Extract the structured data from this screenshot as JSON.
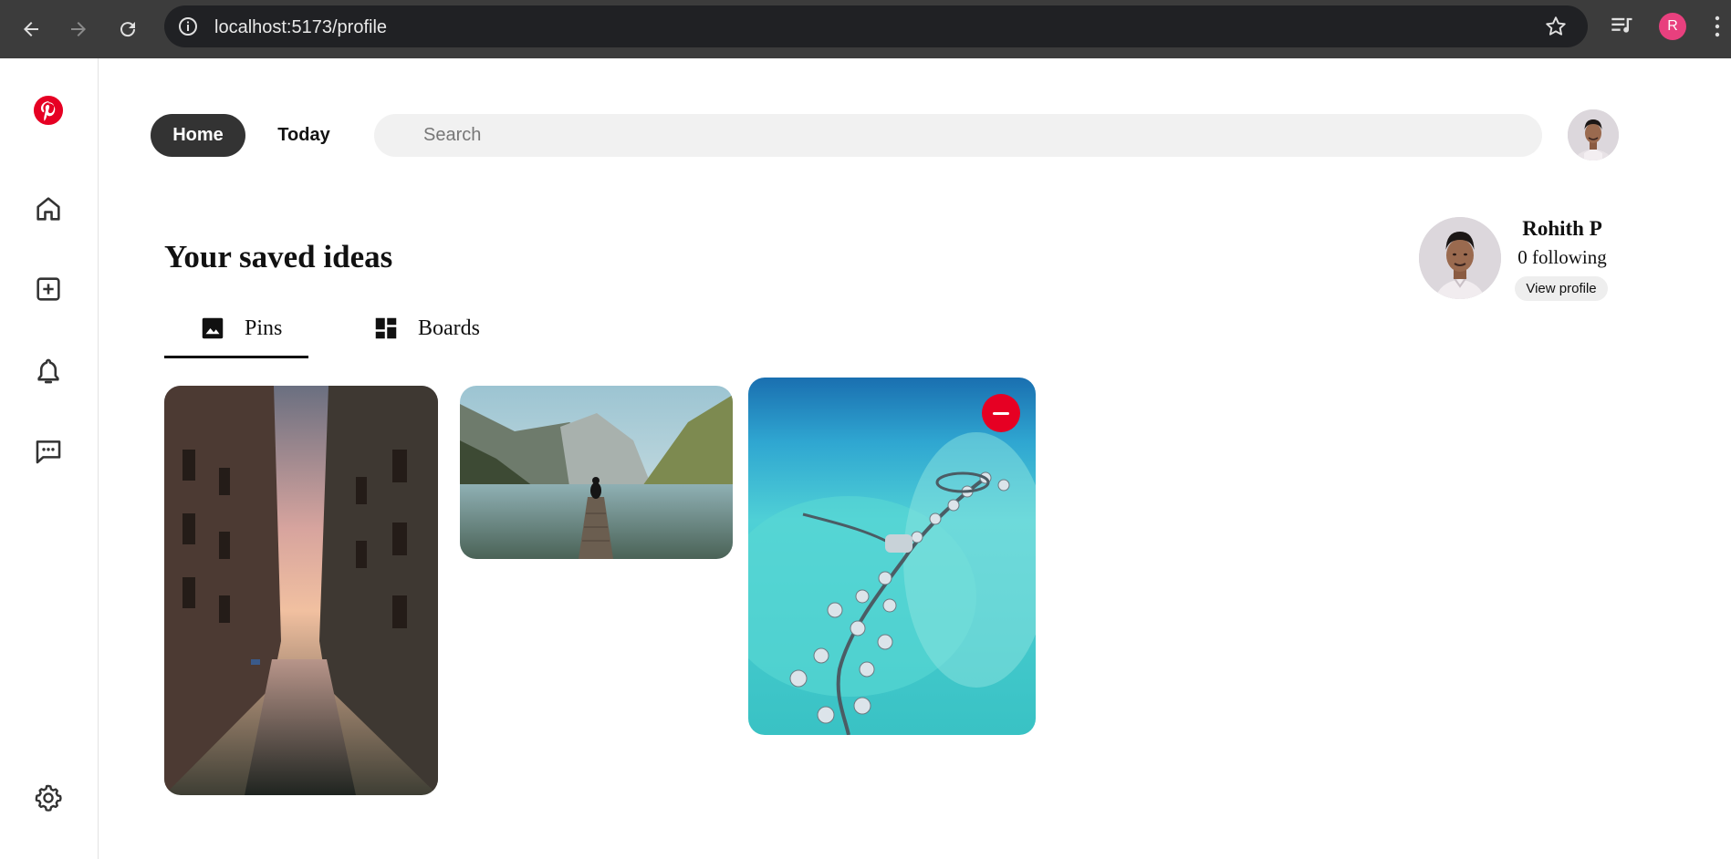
{
  "browser": {
    "url": "localhost:5173/profile",
    "profile_initial": "R"
  },
  "header": {
    "home_label": "Home",
    "today_label": "Today",
    "search_placeholder": "Search"
  },
  "page": {
    "title": "Your saved ideas",
    "tabs": [
      {
        "label": "Pins",
        "active": true
      },
      {
        "label": "Boards",
        "active": false
      }
    ]
  },
  "profile": {
    "name": "Rohith P",
    "following": "0 following",
    "view_profile_label": "View profile"
  },
  "sidebar": {
    "items": [
      "pinterest-logo",
      "home-icon",
      "create-icon",
      "notifications-icon",
      "messages-icon",
      "settings-icon"
    ]
  },
  "pins": [
    {
      "subject": "venice-canal"
    },
    {
      "subject": "mountain-lake-dock"
    },
    {
      "subject": "overwater-villas"
    }
  ],
  "colors": {
    "brand_red": "#e60023",
    "chrome_bg": "#3c3c3c",
    "home_button_bg": "#333333",
    "search_bg": "#f1f1f1"
  }
}
